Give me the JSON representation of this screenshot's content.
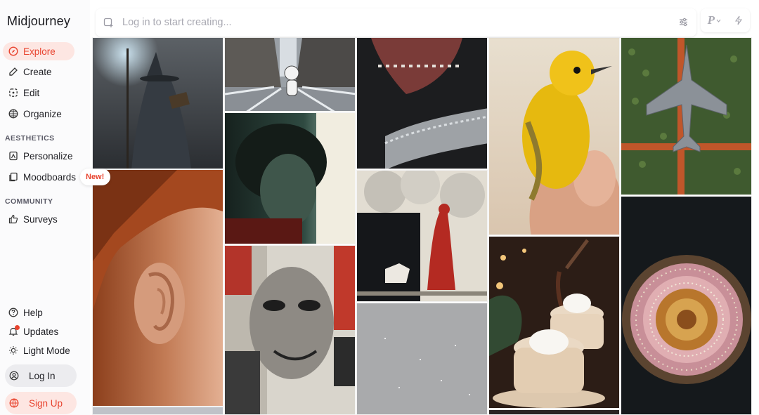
{
  "app": {
    "title": "Midjourney"
  },
  "nav": {
    "explore": "Explore",
    "create": "Create",
    "edit": "Edit",
    "organize": "Organize",
    "aesthetics_label": "AESTHETICS",
    "personalize": "Personalize",
    "moodboards": "Moodboards",
    "new_badge": "New!",
    "community_label": "COMMUNITY",
    "surveys": "Surveys",
    "help": "Help",
    "updates": "Updates",
    "light_mode": "Light Mode",
    "login": "Log In",
    "signup": "Sign Up"
  },
  "search": {
    "placeholder": "Log in to start creating..."
  },
  "toolbar": {
    "personalize_letter": "P"
  },
  "colors": {
    "accent": "#e8442f",
    "accent_bg": "#fde6e2"
  },
  "gallery": {
    "images": [
      "wizard-with-staff",
      "city-street-bear",
      "dog-open-mouth-chain",
      "yellow-bird-hand",
      "fighter-jet-orchard",
      "portrait-green-light",
      "red-riding-hood-print",
      "woman-ear-closeup",
      "collage-face",
      "grey-starfield",
      "hot-chocolate-cups",
      "pink-mandala"
    ]
  }
}
